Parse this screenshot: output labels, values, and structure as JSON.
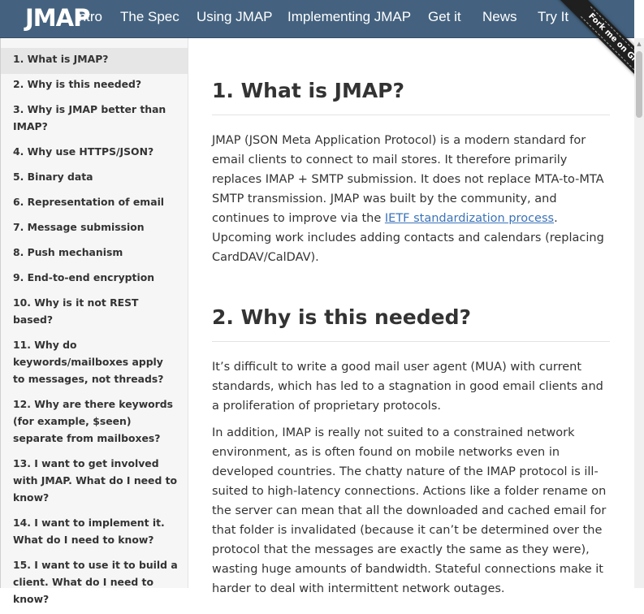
{
  "header": {
    "logo": "JMAP",
    "nav": [
      "Intro",
      "The Spec",
      "Using JMAP",
      "Implementing JMAP",
      "Get it",
      "News",
      "Try It"
    ],
    "ribbon": "Fork me on GitHub"
  },
  "sidebar": {
    "items": [
      "1. What is JMAP?",
      "2. Why is this needed?",
      "3. Why is JMAP better than IMAP?",
      "4. Why use HTTPS/JSON?",
      "5. Binary data",
      "6. Representation of email",
      "7. Message submission",
      "8. Push mechanism",
      "9. End-to-end encryption",
      "10. Why is it not REST based?",
      "11. Why do keywords/mailboxes apply to messages, not threads?",
      "12. Why are there keywords (for example, $seen) separate from mailboxes?",
      "13. I want to get involved with JMAP. What do I need to know?",
      "14. I want to implement it. What do I need to know?",
      "15. I want to use it to build a client. What do I need to know?"
    ]
  },
  "main": {
    "section1": {
      "title": "1. What is JMAP?",
      "p1_before": "JMAP (JSON Meta Application Protocol) is a modern standard for email clients to connect to mail stores. It therefore primarily replaces IMAP + SMTP submission. It does not replace MTA-to-MTA SMTP transmission. JMAP was built by the community, and continues to improve via the ",
      "p1_link": "IETF standardization process",
      "p1_after": ". Upcoming work includes adding contacts and calendars (replacing CardDAV/CalDAV)."
    },
    "section2": {
      "title": "2. Why is this needed?",
      "p1": "It’s difficult to write a good mail user agent (MUA) with current standards, which has led to a stagnation in good email clients and a proliferation of proprietary protocols.",
      "p2": "In addition, IMAP is really not suited to a constrained network environment, as is often found on mobile networks even in developed countries. The chatty nature of the IMAP protocol is ill-suited to high-latency connections. Actions like a folder rename on the server can mean that all the downloaded and cached email for that folder is invalidated (because it can’t be determined over the protocol that the messages are exactly the same as they were), wasting huge amounts of bandwidth. Stateful connections make it harder to deal with intermittent network outages."
    }
  }
}
